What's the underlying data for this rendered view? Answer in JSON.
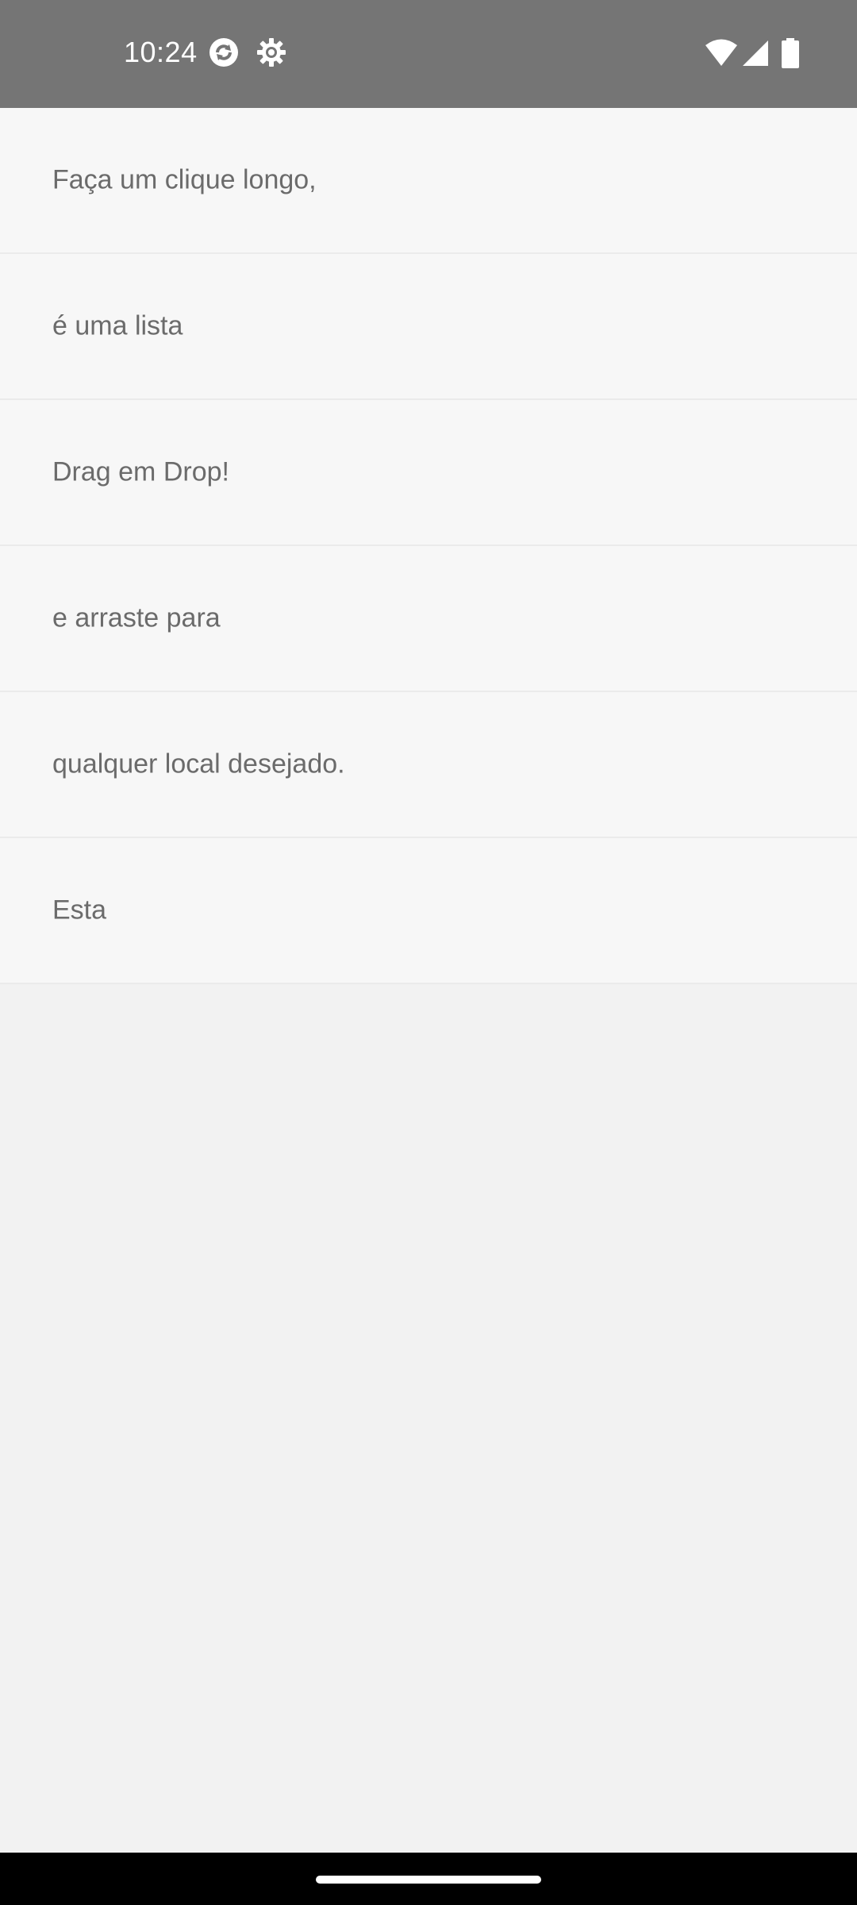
{
  "status_bar": {
    "time": "10:24",
    "icons": [
      "sync-icon",
      "settings-gear-icon",
      "wifi-icon",
      "cellular-signal-icon",
      "battery-icon"
    ]
  },
  "list": {
    "items": [
      {
        "label": "Faça um clique longo,"
      },
      {
        "label": "é uma lista"
      },
      {
        "label": "Drag em Drop!"
      },
      {
        "label": "e arraste para"
      },
      {
        "label": "qualquer local desejado."
      },
      {
        "label": "Esta"
      }
    ]
  },
  "colors": {
    "status_bar": "#757575",
    "list_item_background": "#f7f7f7",
    "page_background": "#f2f2f2",
    "text": "#6b6b6b",
    "nav_bar": "#000000"
  }
}
